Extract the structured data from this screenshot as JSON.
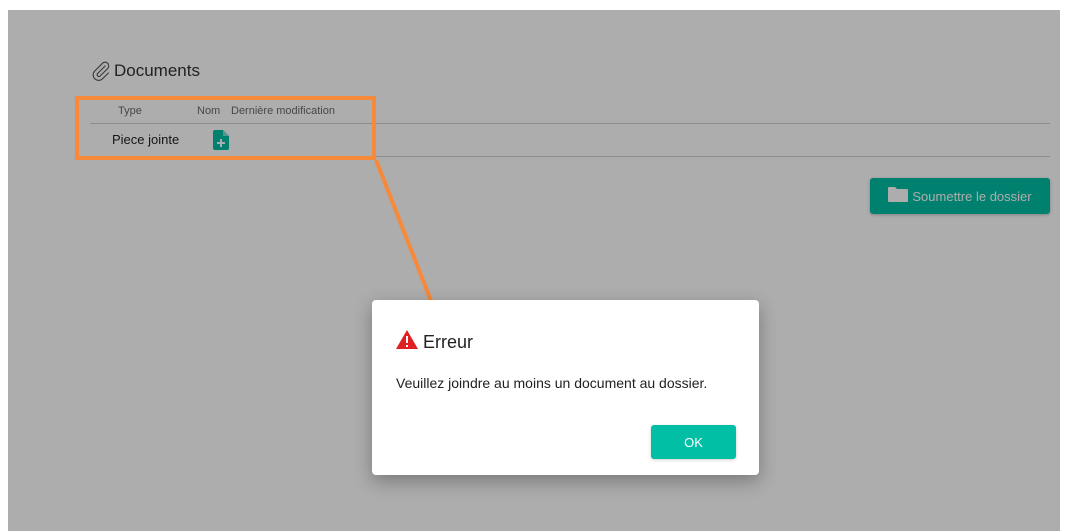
{
  "documents": {
    "title": "Documents",
    "icon": "paperclip-icon",
    "columns": [
      "Type",
      "Nom",
      "Dernière modification"
    ],
    "rows": [
      {
        "type": "Piece jointe",
        "action_icon": "add-file-icon"
      }
    ]
  },
  "submit_button": {
    "label": "Soumettre le dossier",
    "icon": "folder-icon"
  },
  "dialog": {
    "title": "Erreur",
    "icon": "warning-icon",
    "message": "Veuillez joindre au moins un document au dossier.",
    "ok_label": "OK"
  },
  "colors": {
    "accent": "#00bfa5",
    "annotation": "#f7893b",
    "warning": "#e02020"
  }
}
